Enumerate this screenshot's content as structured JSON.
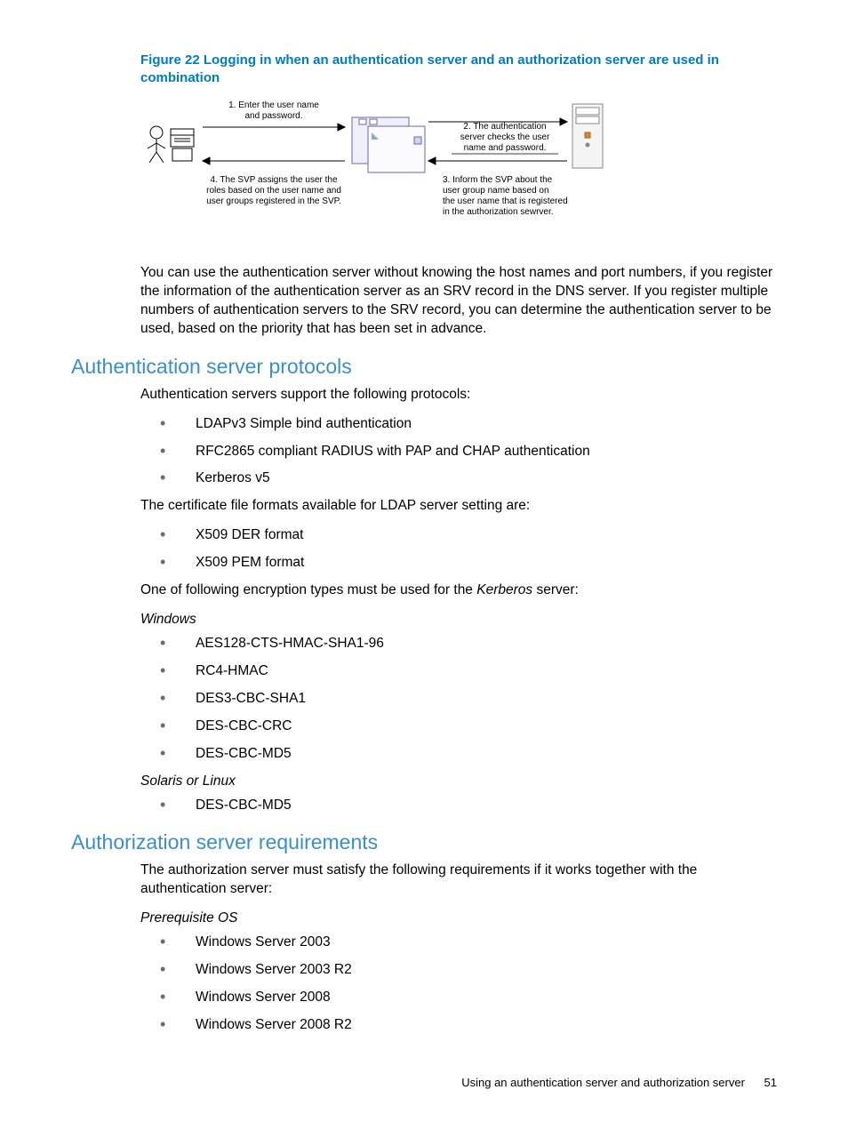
{
  "figure": {
    "caption": "Figure 22 Logging in when an authentication server and an authorization server are used in combination",
    "step1": "1. Enter the user name and password.",
    "step2": "2. The authentication server checks the user name and password.",
    "step3": "3. Inform the SVP about the user group name based on the user name that is registered in the authorization sewrver.",
    "step4": "4. The SVP assigns the user the roles based on the user name and user groups registered in the SVP."
  },
  "intro_paragraph": "You can use the authentication server without knowing the host names and port numbers, if you register the information of the authentication server as an SRV record in the DNS server. If you register multiple numbers of authentication servers to the SRV record, you can determine the authentication server to be used, based on the priority that has been set in advance.",
  "sections": {
    "auth_server_protocols": {
      "heading": "Authentication server protocols",
      "intro": "Authentication servers support the following protocols:",
      "protocol_list": [
        "LDAPv3 Simple bind authentication",
        "RFC2865 compliant RADIUS with PAP and CHAP authentication",
        "Kerberos v5"
      ],
      "cert_intro": "The certificate file formats available for LDAP server setting are:",
      "cert_list": [
        "X509 DER format",
        "X509 PEM format"
      ],
      "enc_intro_prefix": "One of following encryption types must be used for the ",
      "enc_intro_italic": "Kerberos",
      "enc_intro_suffix": " server:",
      "windows_label": "Windows",
      "windows_list": [
        "AES128-CTS-HMAC-SHA1-96",
        "RC4-HMAC",
        "DES3-CBC-SHA1",
        "DES-CBC-CRC",
        "DES-CBC-MD5"
      ],
      "unix_label": "Solaris or Linux",
      "unix_list": [
        "DES-CBC-MD5"
      ]
    },
    "authz_server_requirements": {
      "heading": "Authorization server requirements",
      "intro": "The authorization server must satisfy the following requirements if it works together with the authentication server:",
      "prereq_label": "Prerequisite OS",
      "os_list": [
        "Windows Server 2003",
        "Windows Server 2003 R2",
        "Windows Server 2008",
        "Windows Server 2008 R2"
      ]
    }
  },
  "footer": {
    "text": "Using an authentication server and authorization server",
    "page_number": "51"
  }
}
